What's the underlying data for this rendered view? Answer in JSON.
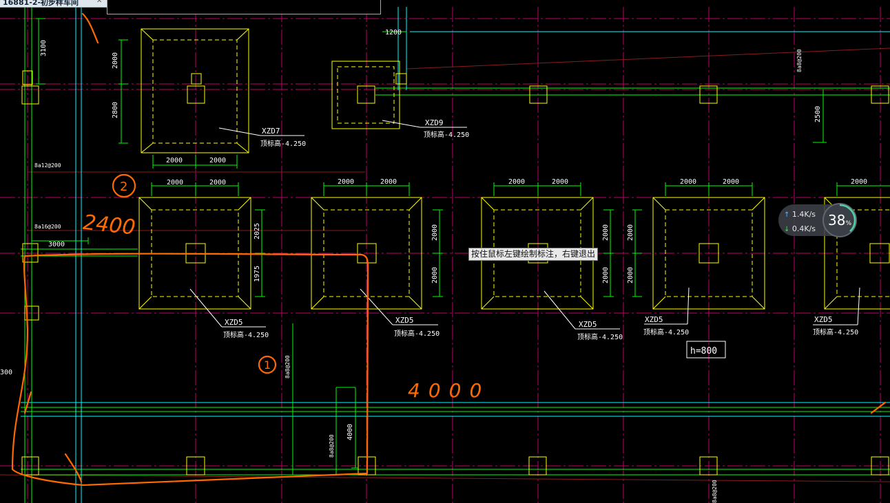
{
  "window": {
    "tab_title": "16881-2-初步样车间",
    "tab_close": "✕"
  },
  "tooltip": "按住鼠标左键绘制标注，右键退出",
  "network": {
    "upload": "1.4K/s",
    "download": "0.4K/s",
    "usage_percent": 38,
    "usage_value": "38",
    "usage_unit": "%"
  },
  "colors": {
    "background": "#000000",
    "axis": "#c0006a",
    "column": "#ffff00",
    "dimension": "#00ff00",
    "beam": "#00ffff",
    "dashed": "#ffff00",
    "markup": "#ff6a00",
    "text": "#ffffff"
  },
  "drawing": {
    "dims": [
      "3100",
      "2000",
      "2800",
      "2000",
      "2000",
      "1200",
      "2500",
      "2000",
      "2000",
      "2000",
      "2000",
      "2000",
      "2000",
      "2000",
      "2000",
      "2000",
      "2000",
      "2000",
      "2025",
      "1975",
      "2000",
      "2000",
      "2000",
      "2000",
      "2000",
      "2000",
      "3000",
      "4000",
      "300"
    ],
    "labels": [
      "XZD7",
      "顶标高-4.250",
      "XZD9",
      "顶标高-4.250",
      "XZD5",
      "顶标高-4.250",
      "XZD5",
      "顶标高-4.250",
      "XZD5",
      "顶标高-4.250",
      "XZD5",
      "顶标高-4.250",
      "XZD5",
      "顶标高-4.250",
      "h=800"
    ],
    "rebar": [
      "8a8@200",
      "8a8@200",
      "8a12@200",
      "8a16@200",
      "8a8@200",
      "8a8@200"
    ],
    "markup": [
      "2",
      "2400",
      "1",
      "4000"
    ]
  }
}
